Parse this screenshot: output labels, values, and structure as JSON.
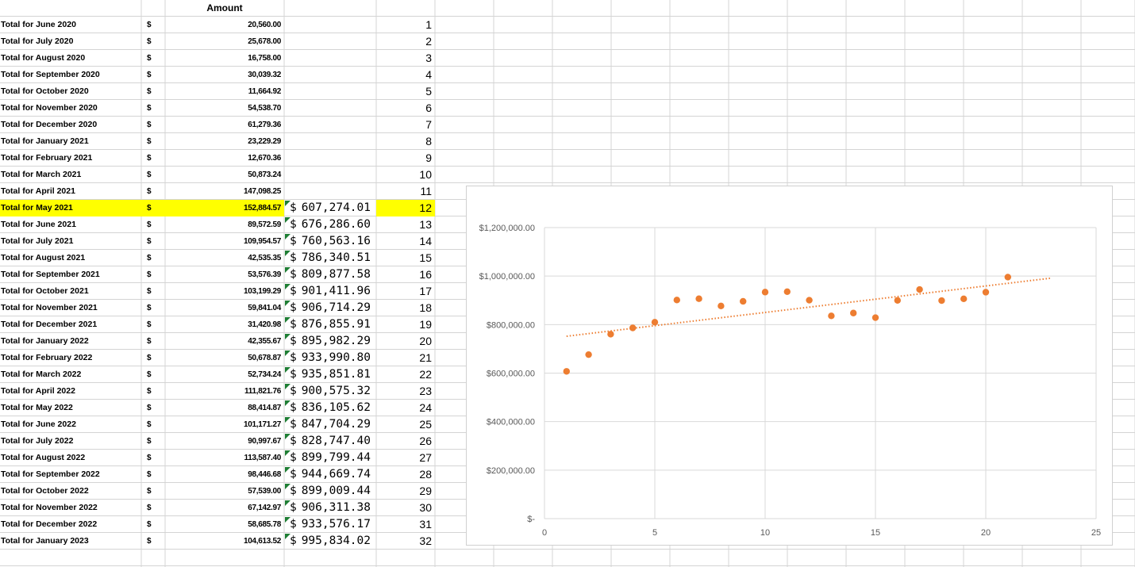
{
  "sheet": {
    "header": "Amount",
    "currency_symbol": "$",
    "highlight_row": 12,
    "rows": [
      {
        "label": "Total for June 2020",
        "amount": "20,560.00",
        "cumulative": "",
        "index": "1"
      },
      {
        "label": "Total for July 2020",
        "amount": "25,678.00",
        "cumulative": "",
        "index": "2"
      },
      {
        "label": "Total for August 2020",
        "amount": "16,758.00",
        "cumulative": "",
        "index": "3"
      },
      {
        "label": "Total for September 2020",
        "amount": "30,039.32",
        "cumulative": "",
        "index": "4"
      },
      {
        "label": "Total for October 2020",
        "amount": "11,664.92",
        "cumulative": "",
        "index": "5"
      },
      {
        "label": "Total for November 2020",
        "amount": "54,538.70",
        "cumulative": "",
        "index": "6"
      },
      {
        "label": "Total for December 2020",
        "amount": "61,279.36",
        "cumulative": "",
        "index": "7"
      },
      {
        "label": "Total for January 2021",
        "amount": "23,229.29",
        "cumulative": "",
        "index": "8"
      },
      {
        "label": "Total for February 2021",
        "amount": "12,670.36",
        "cumulative": "",
        "index": "9"
      },
      {
        "label": "Total for March 2021",
        "amount": "50,873.24",
        "cumulative": "",
        "index": "10"
      },
      {
        "label": "Total for April 2021",
        "amount": "147,098.25",
        "cumulative": "",
        "index": "11"
      },
      {
        "label": "Total for May 2021",
        "amount": "152,884.57",
        "cumulative": "607,274.01",
        "index": "12"
      },
      {
        "label": "Total for June 2021",
        "amount": "89,572.59",
        "cumulative": "676,286.60",
        "index": "13"
      },
      {
        "label": "Total for July 2021",
        "amount": "109,954.57",
        "cumulative": "760,563.16",
        "index": "14"
      },
      {
        "label": "Total for August 2021",
        "amount": "42,535.35",
        "cumulative": "786,340.51",
        "index": "15"
      },
      {
        "label": "Total for September 2021",
        "amount": "53,576.39",
        "cumulative": "809,877.58",
        "index": "16"
      },
      {
        "label": "Total for October 2021",
        "amount": "103,199.29",
        "cumulative": "901,411.96",
        "index": "17"
      },
      {
        "label": "Total for November 2021",
        "amount": "59,841.04",
        "cumulative": "906,714.29",
        "index": "18"
      },
      {
        "label": "Total for December 2021",
        "amount": "31,420.98",
        "cumulative": "876,855.91",
        "index": "19"
      },
      {
        "label": "Total for January 2022",
        "amount": "42,355.67",
        "cumulative": "895,982.29",
        "index": "20"
      },
      {
        "label": "Total for February 2022",
        "amount": "50,678.87",
        "cumulative": "933,990.80",
        "index": "21"
      },
      {
        "label": "Total for March 2022",
        "amount": "52,734.24",
        "cumulative": "935,851.81",
        "index": "22"
      },
      {
        "label": "Total for April 2022",
        "amount": "111,821.76",
        "cumulative": "900,575.32",
        "index": "23"
      },
      {
        "label": "Total for May 2022",
        "amount": "88,414.87",
        "cumulative": "836,105.62",
        "index": "24"
      },
      {
        "label": "Total for June 2022",
        "amount": "101,171.27",
        "cumulative": "847,704.29",
        "index": "25"
      },
      {
        "label": "Total for July 2022",
        "amount": "90,997.67",
        "cumulative": "828,747.40",
        "index": "26"
      },
      {
        "label": "Total for August 2022",
        "amount": "113,587.40",
        "cumulative": "899,799.44",
        "index": "27"
      },
      {
        "label": "Total for September 2022",
        "amount": "98,446.68",
        "cumulative": "944,669.74",
        "index": "28"
      },
      {
        "label": "Total for October 2022",
        "amount": "57,539.00",
        "cumulative": "899,009.44",
        "index": "29"
      },
      {
        "label": "Total for November 2022",
        "amount": "67,142.97",
        "cumulative": "906,311.38",
        "index": "30"
      },
      {
        "label": "Total for December 2022",
        "amount": "58,685.78",
        "cumulative": "933,576.17",
        "index": "31"
      },
      {
        "label": "Total for January 2023",
        "amount": "104,613.52",
        "cumulative": "995,834.02",
        "index": "32"
      }
    ]
  },
  "chart_data": {
    "type": "scatter",
    "x": [
      1,
      2,
      3,
      4,
      5,
      6,
      7,
      8,
      9,
      10,
      11,
      12,
      13,
      14,
      15,
      16,
      17,
      18,
      19,
      20,
      21
    ],
    "y": [
      607274.01,
      676286.6,
      760563.16,
      786340.51,
      809877.58,
      901411.96,
      906714.29,
      876855.91,
      895982.29,
      933990.8,
      935851.81,
      900575.32,
      836105.62,
      847704.29,
      828747.4,
      899799.44,
      944669.74,
      899009.44,
      906311.38,
      933576.17,
      995834.02
    ],
    "xlim": [
      0,
      25
    ],
    "ylim": [
      0,
      1200000
    ],
    "x_ticks": [
      "0",
      "5",
      "10",
      "15",
      "20",
      "25"
    ],
    "y_ticks": [
      "$-",
      "$200,000.00",
      "$400,000.00",
      "$600,000.00",
      "$800,000.00",
      "$1,000,000.00",
      "$1,200,000.00"
    ],
    "trendline": {
      "type": "linear",
      "style": "dotted",
      "x_range": [
        1,
        23
      ]
    },
    "grid": true,
    "colors": {
      "marker": "#ed7d31",
      "trendline": "#ed7d31",
      "gridline": "#d9d9d9"
    },
    "title": "",
    "xlabel": "",
    "ylabel": ""
  },
  "colors": {
    "highlight": "#ffff00",
    "gridline": "#d4d4d4",
    "error_triangle": "#1e7e34"
  }
}
